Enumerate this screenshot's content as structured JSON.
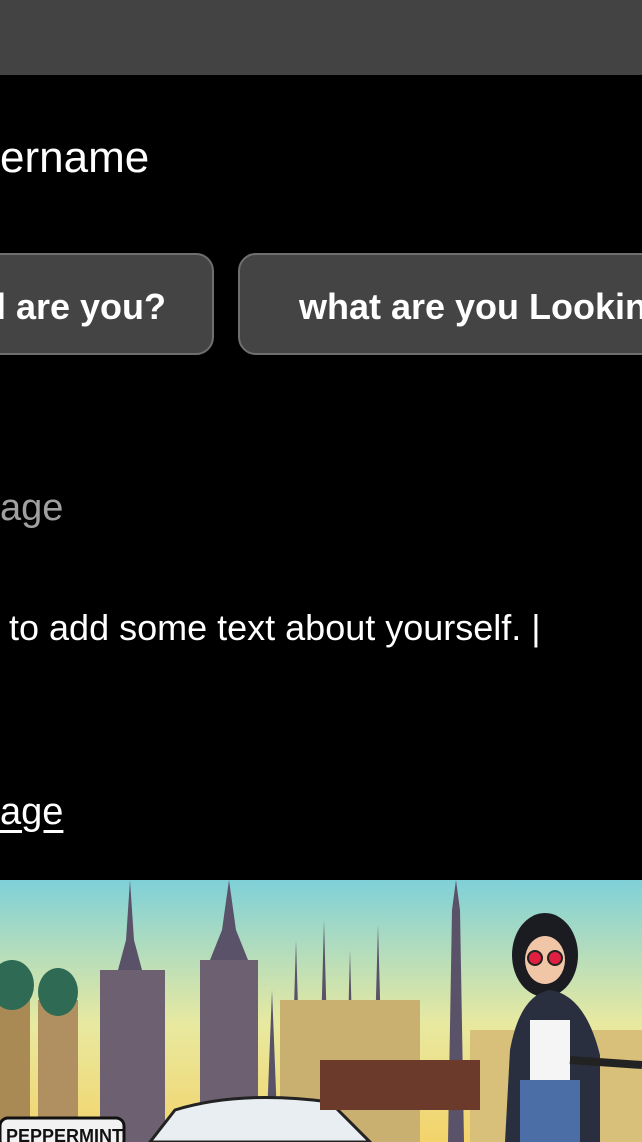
{
  "profile": {
    "username_label": "ername",
    "chips": {
      "who_are_you": "l are you?",
      "looking_for": "what are you Lookin"
    },
    "image_label": "age",
    "about_placeholder": "to add some text about yourself. |",
    "image_link_label": "age"
  },
  "hero_image": {
    "sign_text": "PEPPERMINT"
  }
}
